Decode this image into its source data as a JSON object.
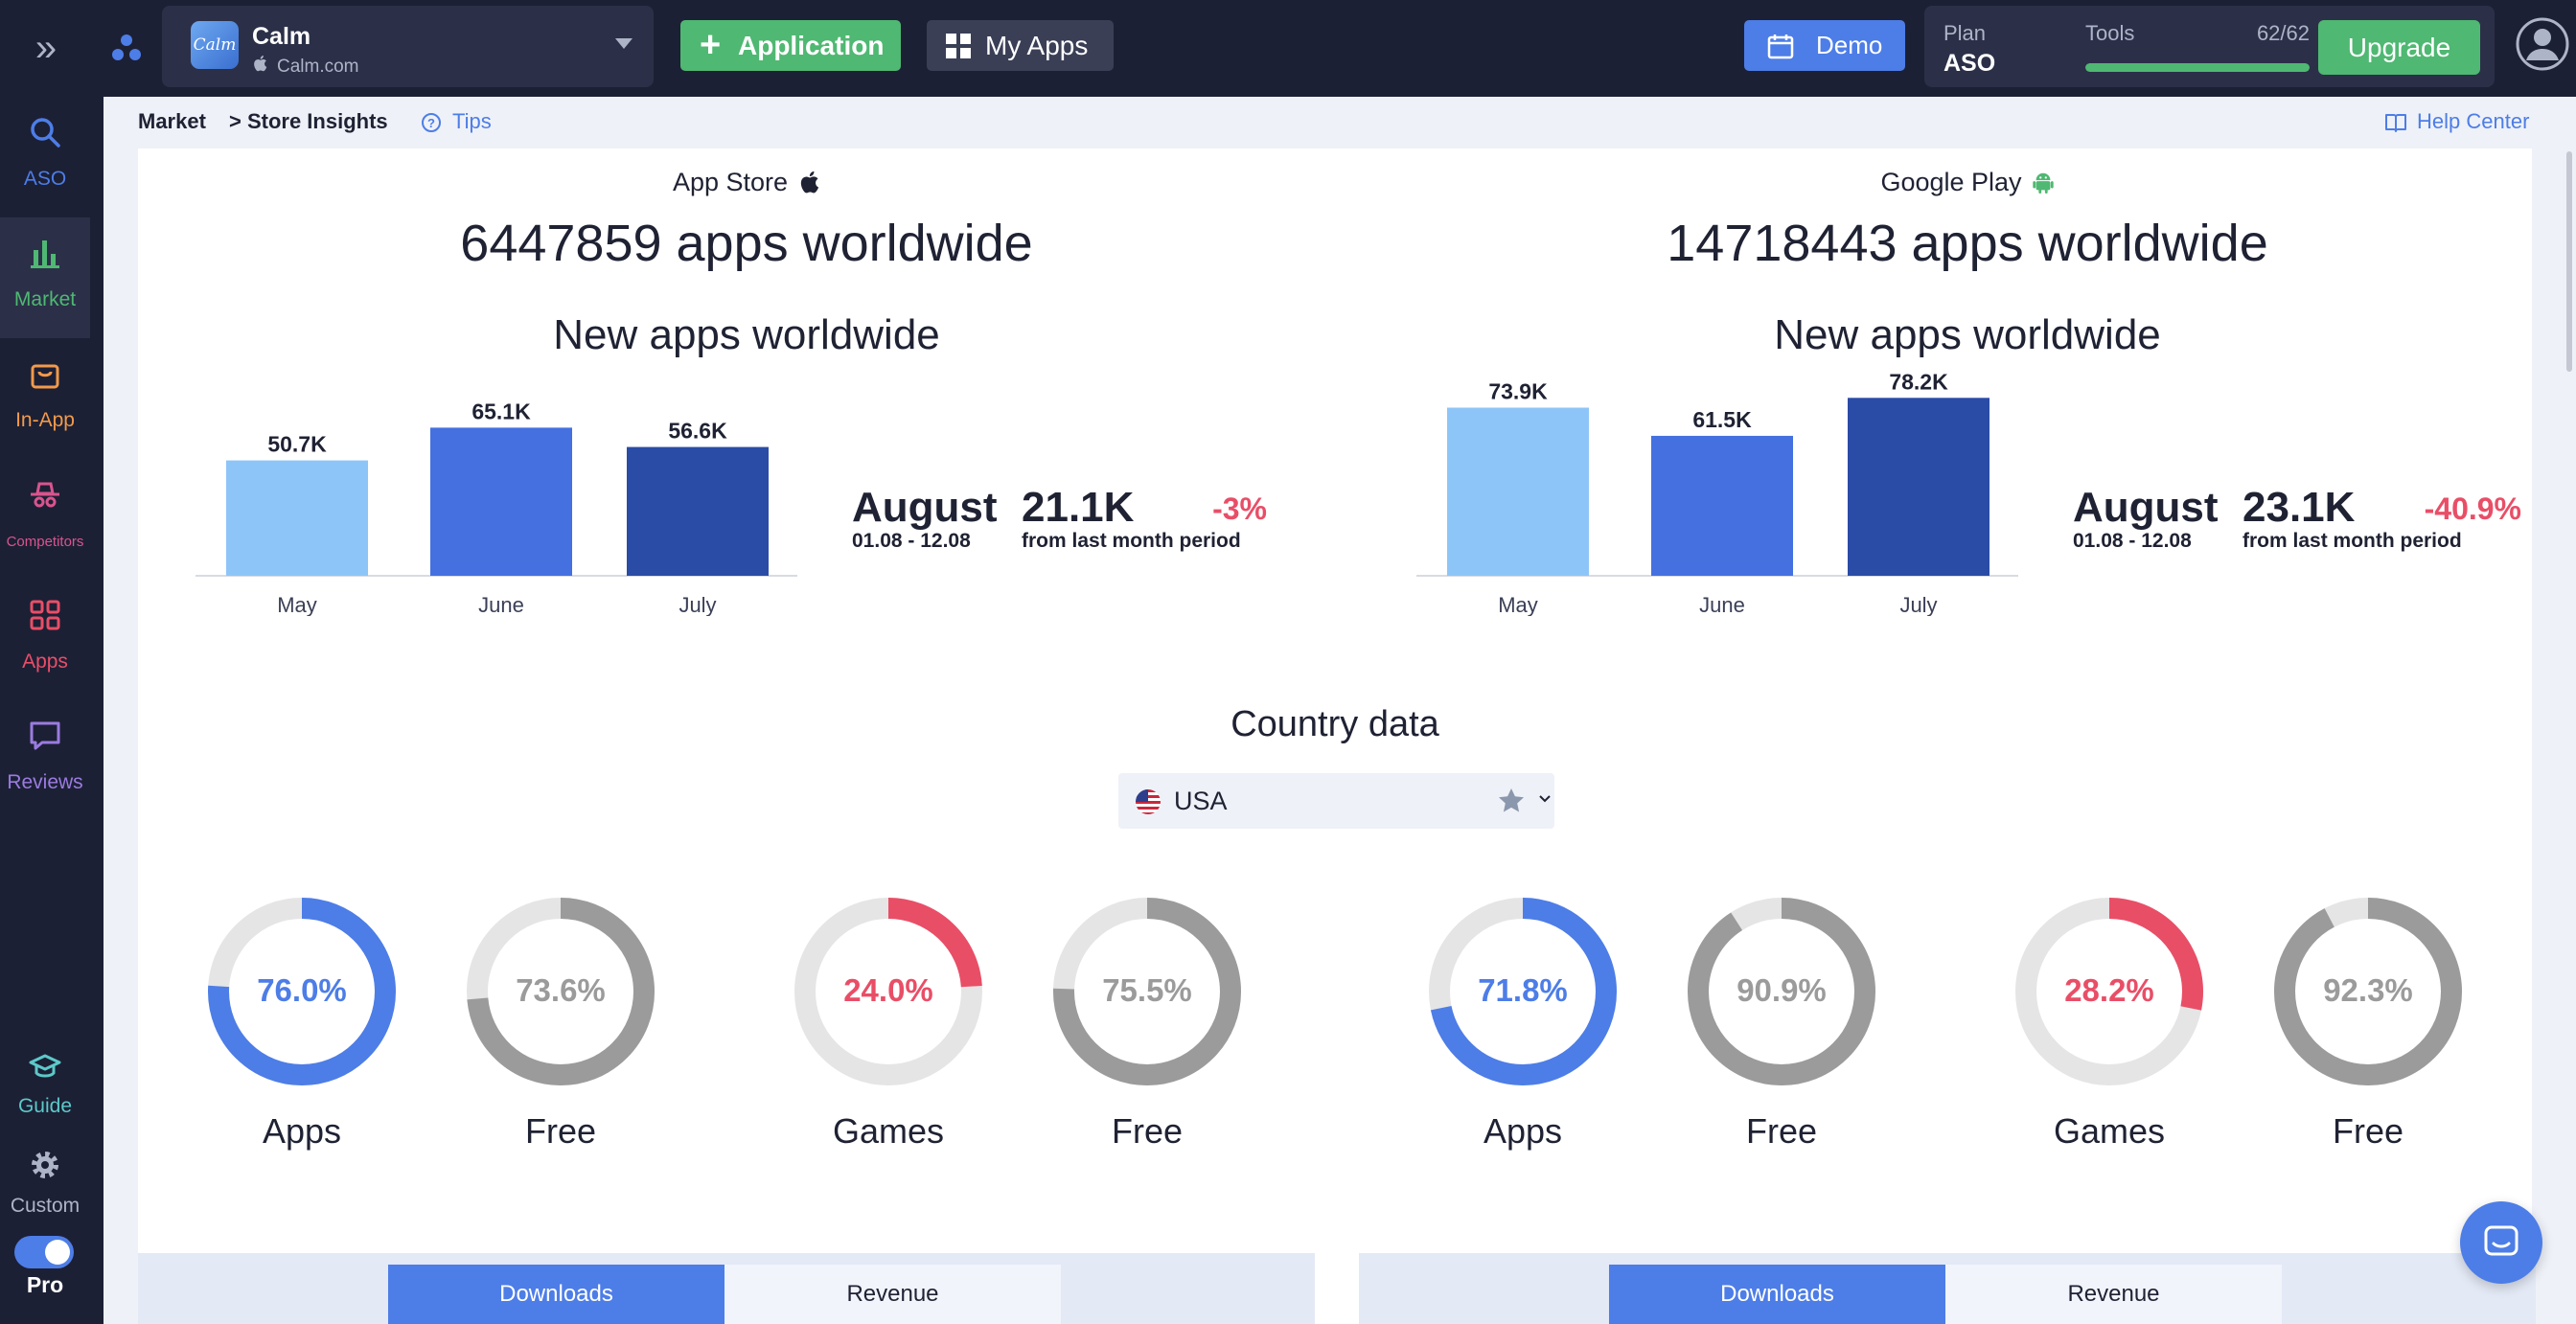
{
  "header": {
    "app": {
      "name": "Calm",
      "developer": "Calm.com",
      "icon_text": "Calm"
    },
    "application_button": "Application",
    "my_apps_button": "My Apps",
    "demo_button": "Demo",
    "plan": {
      "label": "Plan",
      "value": "ASO"
    },
    "tools": {
      "label": "Tools",
      "count": "62/62",
      "fill_fraction": 1.0
    },
    "upgrade_button": "Upgrade"
  },
  "sidebar": {
    "items": [
      {
        "label": "ASO",
        "color": "#4d7de7",
        "icon": "search-icon"
      },
      {
        "label": "Market",
        "color": "#4fb872",
        "icon": "bar-chart-icon",
        "active": true
      },
      {
        "label": "In-App",
        "color": "#f29a4a",
        "icon": "shopping-bag-icon"
      },
      {
        "label": "Competitors",
        "color": "#d9548d",
        "icon": "spy-hat-icon"
      },
      {
        "label": "Apps",
        "color": "#e94e67",
        "icon": "grid-icon"
      },
      {
        "label": "Reviews",
        "color": "#9b7be0",
        "icon": "chat-bubble-icon"
      },
      {
        "label": "Guide",
        "color": "#5cc9c9",
        "icon": "graduation-cap-icon"
      },
      {
        "label": "Custom",
        "color": "#aeb4c8",
        "icon": "gear-icon"
      }
    ],
    "pro_label": "Pro"
  },
  "breadcrumb": {
    "market": "Market",
    "store_insights": "> Store Insights",
    "tips": "Tips"
  },
  "help_center": "Help Center",
  "country": {
    "title": "Country data",
    "selected": "USA"
  },
  "stores": [
    {
      "name": "App Store",
      "icon": "apple-icon",
      "total_apps": "6447859 apps worldwide",
      "new_apps_title": "New apps worldwide",
      "summary": {
        "month": "August",
        "range": "01.08 - 12.08",
        "total": "21.1K",
        "change": "-3%",
        "from_label": "from last month period"
      },
      "donuts": [
        {
          "label": "Apps",
          "pct_text": "76.0%",
          "value": 76.0,
          "color": "#4d7de7"
        },
        {
          "label": "Free",
          "pct_text": "73.6%",
          "value": 73.6,
          "color": "#9b9b9b"
        },
        {
          "label": "Games",
          "pct_text": "24.0%",
          "value": 24.0,
          "color": "#e94e67"
        },
        {
          "label": "Free",
          "pct_text": "75.5%",
          "value": 75.5,
          "color": "#9b9b9b"
        }
      ],
      "tabs": [
        "Downloads",
        "Revenue"
      ]
    },
    {
      "name": "Google Play",
      "icon": "android-icon",
      "total_apps": "14718443 apps worldwide",
      "new_apps_title": "New apps worldwide",
      "summary": {
        "month": "August",
        "range": "01.08 - 12.08",
        "total": "23.1K",
        "change": "-40.9%",
        "from_label": "from last month period"
      },
      "donuts": [
        {
          "label": "Apps",
          "pct_text": "71.8%",
          "value": 71.8,
          "color": "#4d7de7"
        },
        {
          "label": "Free",
          "pct_text": "90.9%",
          "value": 90.9,
          "color": "#9b9b9b"
        },
        {
          "label": "Games",
          "pct_text": "28.2%",
          "value": 28.2,
          "color": "#e94e67"
        },
        {
          "label": "Free",
          "pct_text": "92.3%",
          "value": 92.3,
          "color": "#9b9b9b"
        }
      ],
      "tabs": [
        "Downloads",
        "Revenue"
      ]
    }
  ],
  "chart_data": [
    {
      "type": "bar",
      "title": "New apps worldwide",
      "categories": [
        "May",
        "June",
        "July"
      ],
      "values": [
        50.7,
        65.1,
        56.6
      ],
      "value_labels": [
        "50.7K",
        "65.1K",
        "56.6K"
      ],
      "colors": [
        "#8ec5f8",
        "#4470e0",
        "#2a4ca6"
      ],
      "ylim": [
        0,
        80
      ]
    },
    {
      "type": "bar",
      "title": "New apps worldwide",
      "categories": [
        "May",
        "June",
        "July"
      ],
      "values": [
        73.9,
        61.5,
        78.2
      ],
      "value_labels": [
        "73.9K",
        "61.5K",
        "78.2K"
      ],
      "colors": [
        "#8ec5f8",
        "#4470e0",
        "#2a4ca6"
      ],
      "ylim": [
        0,
        80
      ]
    }
  ]
}
